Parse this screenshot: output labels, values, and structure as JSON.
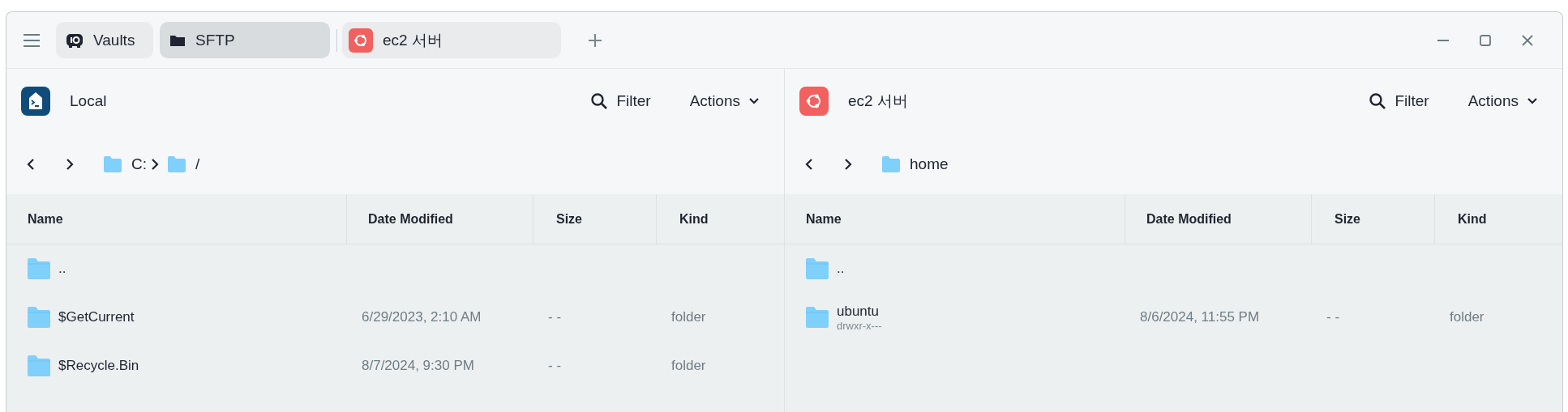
{
  "tabs": [
    {
      "kind": "vaults",
      "label": "Vaults",
      "selected": false
    },
    {
      "kind": "sftp",
      "label": "SFTP",
      "selected": true
    },
    {
      "kind": "host",
      "label": "ec2 서버",
      "selected": false
    }
  ],
  "panes": [
    {
      "kind": "local",
      "title": "Local",
      "filter": "Filter",
      "actions": "Actions",
      "path": [
        "C:",
        "/"
      ],
      "columns": [
        "Name",
        "Date Modified",
        "Size",
        "Kind"
      ],
      "rows": [
        {
          "name": ".."
        },
        {
          "name": "$GetCurrent",
          "date": "6/29/2023, 2:10 AM",
          "size": "- -",
          "kind": "folder"
        },
        {
          "name": "$Recycle.Bin",
          "date": "8/7/2024, 9:30 PM",
          "size": "- -",
          "kind": "folder"
        }
      ]
    },
    {
      "kind": "host",
      "title": "ec2 서버",
      "filter": "Filter",
      "actions": "Actions",
      "path": [
        "home"
      ],
      "columns": [
        "Name",
        "Date Modified",
        "Size",
        "Kind"
      ],
      "rows": [
        {
          "name": ".."
        },
        {
          "name": "ubuntu",
          "permissions": "drwxr-x---",
          "date": "8/6/2024, 11:55 PM",
          "size": "- -",
          "kind": "folder"
        }
      ]
    }
  ]
}
